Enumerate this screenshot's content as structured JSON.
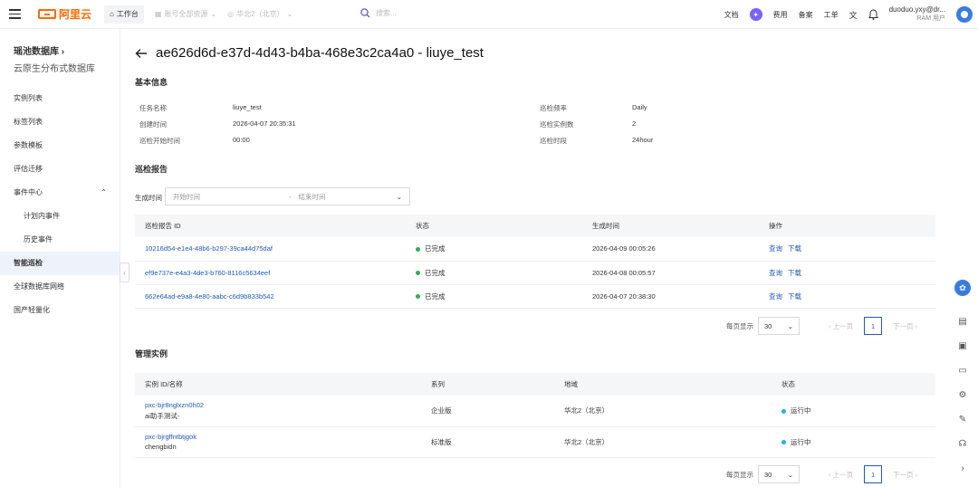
{
  "topbar": {
    "logo_text": "阿里云",
    "workbench": "工作台",
    "resource_group": "账号全部资源",
    "region": "华北2（北京）",
    "search_placeholder": "搜索...",
    "links": [
      "文档",
      "费用",
      "备案",
      "工单"
    ],
    "user_name": "duoduo.yxy@dr...",
    "user_role": "RAM 用户",
    "accent": "#ff6a00"
  },
  "sidebar": {
    "title": "瑶池数据库",
    "subtitle": "云原生分布式数据库",
    "items": [
      {
        "label": "实例列表"
      },
      {
        "label": "标签列表"
      },
      {
        "label": "参数模板"
      },
      {
        "label": "评估迁移"
      },
      {
        "label": "事件中心"
      },
      {
        "label": "计划内事件"
      },
      {
        "label": "历史事件"
      },
      {
        "label": "智能巡检"
      },
      {
        "label": "全球数据库网络"
      },
      {
        "label": "国产轻量化"
      }
    ]
  },
  "page": {
    "title": "ae626d6d-e37d-4d43-b4ba-468e3c2ca4a0 - liuye_test"
  },
  "basic_info": {
    "section_title": "基本信息",
    "task_name_label": "任务名称",
    "task_name": "liuye_test",
    "created_label": "创建时间",
    "created": "2026-04-07 20:35:31",
    "start_label": "巡检开始时间",
    "start": "00:00",
    "freq_label": "巡检频率",
    "freq": "Daily",
    "count_label": "巡检实例数",
    "count": "2",
    "period_label": "巡检时段",
    "period": "24hour"
  },
  "report": {
    "section_title": "巡检报告",
    "filter_label": "生成时间",
    "start_placeholder": "开始时间",
    "range_sep": "-",
    "end_placeholder": "结束时间",
    "columns": [
      "巡检报告 ID",
      "状态",
      "生成时间",
      "操作"
    ],
    "rows": [
      {
        "id": "10216d54-e1e4-48b6-b297-39ca44d75daf",
        "status": "已完成",
        "time": "2026-04-09 00:05:26",
        "op1": "查询",
        "op2": "下载"
      },
      {
        "id": "ef9e737e-e4a3-4de3-b760-8116c5634eef",
        "status": "已完成",
        "time": "2026-04-08 00:05:57",
        "op1": "查询",
        "op2": "下载"
      },
      {
        "id": "662e64ad-e9a8-4e80-aabc-c6d9b833b542",
        "status": "已完成",
        "time": "2026-04-07 20:38:30",
        "op1": "查询",
        "op2": "下载"
      }
    ],
    "status_color": "#2fae4f"
  },
  "pager": {
    "per_page_label": "每页显示",
    "per_page": "30",
    "prev": "上一页",
    "page": "1",
    "next": "下一页"
  },
  "instances": {
    "section_title": "管理实例",
    "columns": [
      "实例 ID/名称",
      "系列",
      "地域",
      "状态"
    ],
    "rows": [
      {
        "id": "pxc-bjr8nglxzn0h02",
        "name": "ai助手测试-",
        "series": "企业版",
        "region": "华北2（北京）",
        "status": "运行中"
      },
      {
        "id": "pxc-bjrgffntbtjgok",
        "name": "chengbidn",
        "series": "标准版",
        "region": "华北2（北京）",
        "status": "运行中"
      }
    ],
    "status_color": "#1fb5d6"
  }
}
